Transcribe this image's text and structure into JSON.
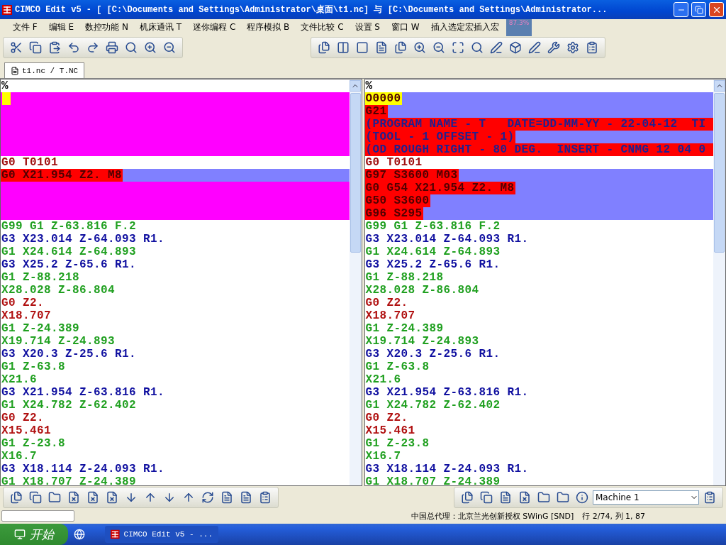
{
  "window": {
    "title": "CIMCO Edit v5 - [ [C:\\Documents and Settings\\Administrator\\桌面\\t1.nc] 与 [C:\\Documents and Settings\\Administrator..."
  },
  "menu": [
    "文件 F",
    "编辑 E",
    "数控功能 N",
    "机床通讯 T",
    "迷你编程 C",
    "程序模拟 B",
    "文件比较 C",
    "设置 S",
    "窗口 W",
    "插入选定宏插入宏"
  ],
  "zoom_badge": "87.3%",
  "tabs": [
    {
      "label": "t1.nc / T.NC",
      "selected": true
    }
  ],
  "panes": [
    {
      "lines": [
        {
          "text": "%",
          "color": "#000000",
          "kind": "plain"
        },
        {
          "kind": "removed",
          "cursor": true
        },
        {
          "kind": "removed"
        },
        {
          "kind": "removed"
        },
        {
          "kind": "removed"
        },
        {
          "kind": "removed"
        },
        {
          "text": "G0 T0101",
          "color": "#a01010",
          "kind": "plain"
        },
        {
          "text": "G0 X21.954 Z2. M8",
          "comment": false,
          "kind": "changed",
          "marked": true
        },
        {
          "kind": "removed"
        },
        {
          "kind": "removed"
        },
        {
          "kind": "removed"
        },
        {
          "text": "G99 G1 Z-63.816 F.2",
          "color": "#20a020",
          "kind": "plain"
        },
        {
          "text": "G3 X23.014 Z-64.093 R1.",
          "color": "#1010a0",
          "kind": "plain"
        },
        {
          "text": "G1 X24.614 Z-64.893",
          "color": "#20a020",
          "kind": "plain"
        },
        {
          "text": "G3 X25.2 Z-65.6 R1.",
          "color": "#1010a0",
          "kind": "plain"
        },
        {
          "text": "G1 Z-88.218",
          "color": "#20a020",
          "kind": "plain"
        },
        {
          "text": "X28.028 Z-86.804",
          "color": "#20a020",
          "kind": "plain"
        },
        {
          "text": "G0 Z2.",
          "color": "#b01010",
          "kind": "plain"
        },
        {
          "text": "X18.707",
          "color": "#b01010",
          "kind": "plain"
        },
        {
          "text": "G1 Z-24.389",
          "color": "#20a020",
          "kind": "plain"
        },
        {
          "text": "X19.714 Z-24.893",
          "color": "#20a020",
          "kind": "plain"
        },
        {
          "text": "G3 X20.3 Z-25.6 R1.",
          "color": "#1010a0",
          "kind": "plain"
        },
        {
          "text": "G1 Z-63.8",
          "color": "#20a020",
          "kind": "plain"
        },
        {
          "text": "X21.6",
          "color": "#20a020",
          "kind": "plain"
        },
        {
          "text": "G3 X21.954 Z-63.816 R1.",
          "color": "#1010a0",
          "kind": "plain"
        },
        {
          "text": "G1 X24.782 Z-62.402",
          "color": "#20a020",
          "kind": "plain"
        },
        {
          "text": "G0 Z2.",
          "color": "#b01010",
          "kind": "plain"
        },
        {
          "text": "X15.461",
          "color": "#b01010",
          "kind": "plain"
        },
        {
          "text": "G1 Z-23.8",
          "color": "#20a020",
          "kind": "plain"
        },
        {
          "text": "X16.7",
          "color": "#20a020",
          "kind": "plain"
        },
        {
          "text": "G3 X18.114 Z-24.093 R1.",
          "color": "#1010a0",
          "kind": "plain"
        },
        {
          "text": "G1 X18.707 Z-24.389",
          "color": "#20a020",
          "kind": "plain"
        }
      ]
    },
    {
      "lines": [
        {
          "text": "%",
          "color": "#000000",
          "kind": "plain"
        },
        {
          "text": "O0000",
          "comment": false,
          "kind": "changed",
          "cursor": true
        },
        {
          "text": "G21",
          "comment": false,
          "kind": "changed",
          "marked": true
        },
        {
          "text": "(PROGRAM NAME - T   DATE=DD-MM-YY - 22-04-12  TI",
          "comment": true,
          "kind": "replaced"
        },
        {
          "text": "(TOOL - 1 OFFSET - 1)",
          "comment": true,
          "kind": "changed",
          "marked": true
        },
        {
          "text": "(OD ROUGH RIGHT - 80 DEG.  INSERT - CNMG 12 04 0",
          "comment": true,
          "kind": "replaced"
        },
        {
          "text": "G0 T0101",
          "color": "#a01010",
          "kind": "plain"
        },
        {
          "text": "G97 S3600 M03",
          "comment": false,
          "kind": "changed",
          "marked": true
        },
        {
          "text": "G0 G54 X21.954 Z2. M8",
          "comment": false,
          "kind": "changed",
          "marked": true
        },
        {
          "text": "G50 S3600",
          "comment": false,
          "kind": "changed",
          "marked": true
        },
        {
          "text": "G96 S295",
          "comment": false,
          "kind": "changed",
          "marked": true
        },
        {
          "text": "G99 G1 Z-63.816 F.2",
          "color": "#20a020",
          "kind": "plain"
        },
        {
          "text": "G3 X23.014 Z-64.093 R1.",
          "color": "#1010a0",
          "kind": "plain"
        },
        {
          "text": "G1 X24.614 Z-64.893",
          "color": "#20a020",
          "kind": "plain"
        },
        {
          "text": "G3 X25.2 Z-65.6 R1.",
          "color": "#1010a0",
          "kind": "plain"
        },
        {
          "text": "G1 Z-88.218",
          "color": "#20a020",
          "kind": "plain"
        },
        {
          "text": "X28.028 Z-86.804",
          "color": "#20a020",
          "kind": "plain"
        },
        {
          "text": "G0 Z2.",
          "color": "#b01010",
          "kind": "plain"
        },
        {
          "text": "X18.707",
          "color": "#b01010",
          "kind": "plain"
        },
        {
          "text": "G1 Z-24.389",
          "color": "#20a020",
          "kind": "plain"
        },
        {
          "text": "X19.714 Z-24.893",
          "color": "#20a020",
          "kind": "plain"
        },
        {
          "text": "G3 X20.3 Z-25.6 R1.",
          "color": "#1010a0",
          "kind": "plain"
        },
        {
          "text": "G1 Z-63.8",
          "color": "#20a020",
          "kind": "plain"
        },
        {
          "text": "X21.6",
          "color": "#20a020",
          "kind": "plain"
        },
        {
          "text": "G3 X21.954 Z-63.816 R1.",
          "color": "#1010a0",
          "kind": "plain"
        },
        {
          "text": "G1 X24.782 Z-62.402",
          "color": "#20a020",
          "kind": "plain"
        },
        {
          "text": "G0 Z2.",
          "color": "#b01010",
          "kind": "plain"
        },
        {
          "text": "X15.461",
          "color": "#b01010",
          "kind": "plain"
        },
        {
          "text": "G1 Z-23.8",
          "color": "#20a020",
          "kind": "plain"
        },
        {
          "text": "X16.7",
          "color": "#20a020",
          "kind": "plain"
        },
        {
          "text": "G3 X18.114 Z-24.093 R1.",
          "color": "#1010a0",
          "kind": "plain"
        },
        {
          "text": "G1 X18.707 Z-24.389",
          "color": "#20a020",
          "kind": "plain"
        }
      ]
    }
  ],
  "machine_select": {
    "value": "Machine 1"
  },
  "status_bar": {
    "agent": "中国总代理：北京兰光创新授权 SWinG [SND]",
    "position": "行 2/74, 列 1, 87"
  },
  "taskbar": {
    "start": "开始",
    "tasks": [
      "CIMCO Edit v5 - ..."
    ]
  }
}
